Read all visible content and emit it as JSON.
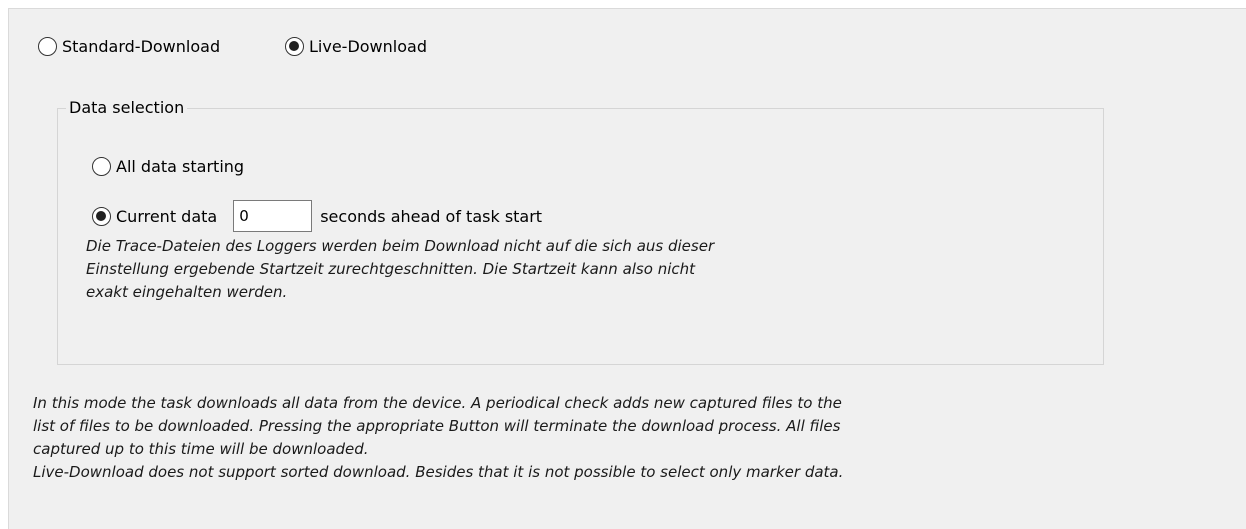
{
  "download_mode": {
    "standard_label": "Standard-Download",
    "live_label": "Live-Download",
    "selected": "live"
  },
  "data_selection": {
    "title": "Data selection",
    "all_data_label": "All data starting",
    "current_data_label": "Current data",
    "seconds_value": "0",
    "seconds_suffix": "seconds ahead of task start",
    "selected": "current",
    "note_lines": [
      "Die Trace-Dateien des Loggers werden beim Download nicht auf die sich aus dieser",
      "Einstellung ergebende Startzeit zurechtgeschnitten. Die Startzeit kann also nicht",
      "exakt eingehalten werden."
    ]
  },
  "description_lines": [
    "In this mode the task downloads all data from the device. A periodical check adds new captured files to the",
    "list of files to be downloaded. Pressing the appropriate Button will terminate the download process. All files",
    "captured up to this time will be downloaded.",
    "Live-Download does not support sorted download. Besides that it is not possible to select only marker data."
  ]
}
